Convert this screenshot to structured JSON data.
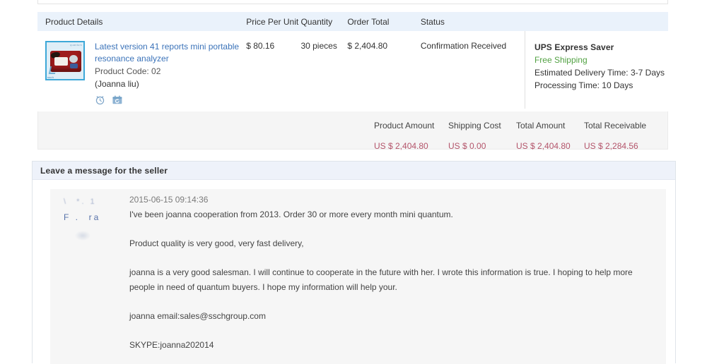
{
  "order_table": {
    "columns": [
      "Product Details",
      "Price Per Unit",
      "Quantity",
      "Order Total",
      "Status"
    ],
    "row": {
      "product_title": "Latest version 41 reports mini portable resonance analyzer",
      "product_code": "Product Code: 02",
      "owner": "(Joanna liu)",
      "icons": [
        "alarm-clock-icon",
        "calendar-refresh-icon"
      ],
      "price_per_unit": "$ 80.16",
      "quantity": "30 pieces",
      "order_total": "$ 2,404.80",
      "status": "Confirmation Received",
      "shipping": {
        "method": "UPS Express Saver",
        "free_shipping": "Free Shipping",
        "estimated_delivery": "Estimated Delivery Time: 3-7 Days",
        "processing_time": "Processing Time: 10 Days"
      }
    }
  },
  "totals": {
    "items": [
      {
        "label": "Product Amount",
        "value": "US $ 2,404.80"
      },
      {
        "label": "Shipping Cost",
        "value": "US $ 0.00"
      },
      {
        "label": "Total Amount",
        "value": "US $ 2,404.80"
      },
      {
        "label": "Total Receivable",
        "value": "US $ 2,284.56"
      }
    ]
  },
  "message_section": {
    "header": "Leave a message for the seller",
    "user_fragment_1": "\\  *. 1",
    "user_fragment_2": "F .  ra",
    "timestamp": "2015-06-15 09:14:36",
    "paragraphs": [
      "I've been joanna cooperation from 2013. Order 30 or more every month mini quantum.",
      "Product quality is very good, very fast delivery,",
      "joanna is a very good salesman. I will continue to cooperate in the future with her. I wrote this information is true. I hoping to help more people in need of quantum buyers. I hope my information will help your.",
      "joanna email:sales@sschgroup.com",
      "SKYPE:joanna202014"
    ]
  },
  "colors": {
    "header_bg": "#eaf2fb",
    "link": "#3b73b9",
    "free_shipping": "#53a244",
    "money": "#b4556b",
    "panel_bg": "#f6f6f6",
    "msg_header_bg": "#eef2fa"
  }
}
